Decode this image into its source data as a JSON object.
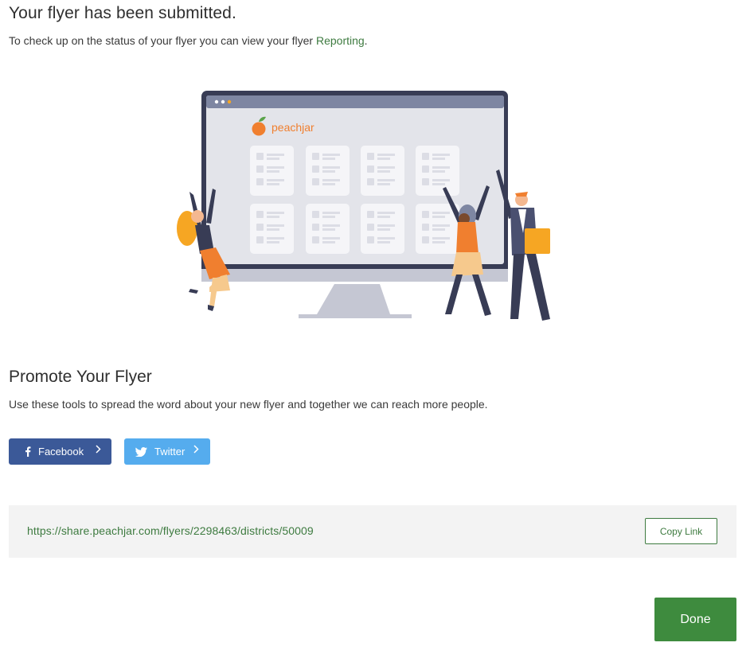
{
  "header": {
    "title": "Your flyer has been submitted.",
    "status_prefix": "To check up on the status of your flyer you can view your flyer ",
    "reporting_link": "Reporting",
    "status_suffix": "."
  },
  "illustration": {
    "brand": "peachjar"
  },
  "promote": {
    "title": "Promote Your Flyer",
    "description": "Use these tools to spread the word about your new flyer and together we can reach more people.",
    "facebook_label": "Facebook",
    "twitter_label": "Twitter"
  },
  "share": {
    "link": "https://share.peachjar.com/flyers/2298463/districts/50009",
    "copy_label": "Copy Link"
  },
  "footer": {
    "done_label": "Done"
  },
  "colors": {
    "accent_green": "#3e7b40",
    "done_green": "#3e8b3e",
    "facebook_blue": "#3b5998",
    "twitter_blue": "#55acee",
    "panel_gray": "#f3f3f3"
  },
  "icons": {
    "facebook": "facebook-icon",
    "twitter": "twitter-icon",
    "chevron": "chevron-right-icon"
  }
}
